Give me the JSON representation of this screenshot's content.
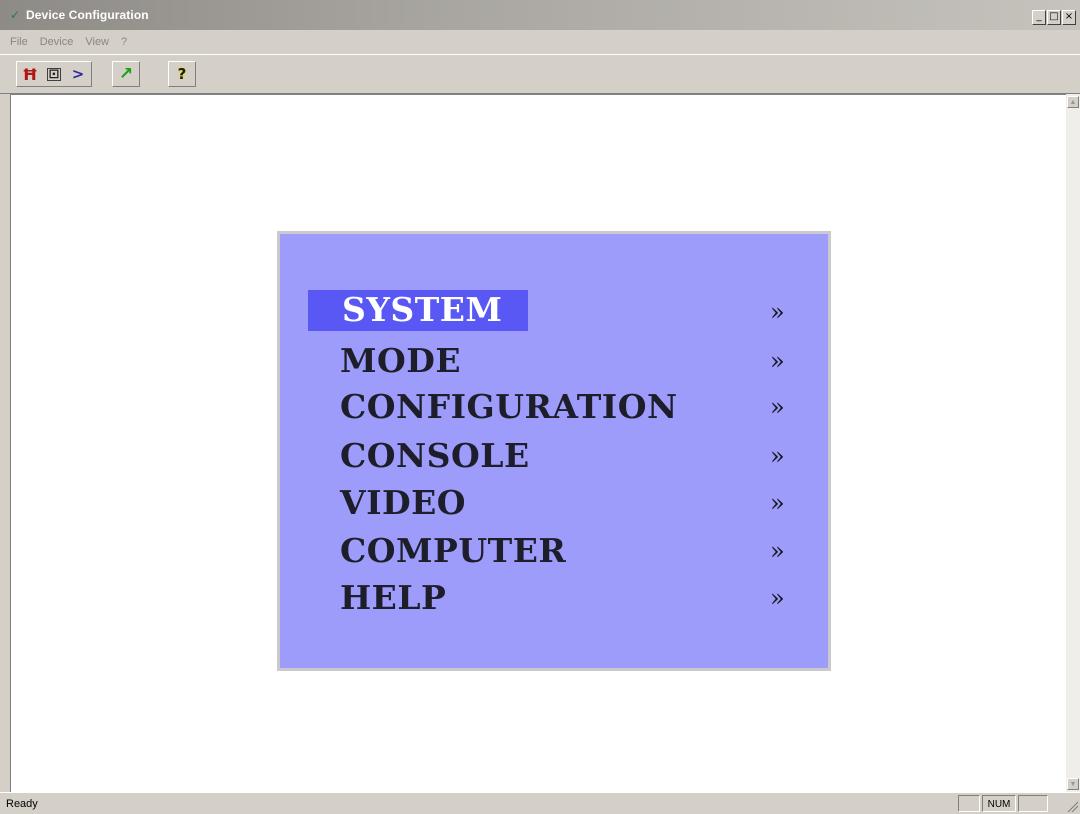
{
  "window": {
    "title": "Device Configuration",
    "controls": [
      "_",
      "□",
      "×"
    ]
  },
  "menubar": {
    "items": [
      "File",
      "Device",
      "View",
      "?"
    ]
  },
  "toolbar": {
    "buttons": [
      {
        "icon": "exit-icon",
        "glyph": "⛿"
      },
      {
        "icon": "properties-icon",
        "glyph": "⎘"
      },
      {
        "icon": "connect-icon",
        "glyph": "⇝"
      },
      {
        "icon": "refresh-icon",
        "glyph": "↗"
      },
      {
        "icon": "help-icon",
        "glyph": "?"
      }
    ]
  },
  "osd_menu": {
    "items": [
      {
        "label": "SYSTEM",
        "arrow": "»",
        "selected": true
      },
      {
        "label": "MODE",
        "arrow": "»"
      },
      {
        "label": "CONFIGURATION",
        "arrow": "»"
      },
      {
        "label": "CONSOLE",
        "arrow": "»"
      },
      {
        "label": "VIDEO",
        "arrow": "»"
      },
      {
        "label": "COMPUTER",
        "arrow": "»"
      },
      {
        "label": "HELP",
        "arrow": "»"
      }
    ],
    "colors": {
      "background": "#9d9cfb",
      "highlight": "#5a58f5",
      "text": "#1e1e2a"
    }
  },
  "statusbar": {
    "text": "Ready",
    "panes": [
      "",
      "NUM",
      ""
    ]
  }
}
